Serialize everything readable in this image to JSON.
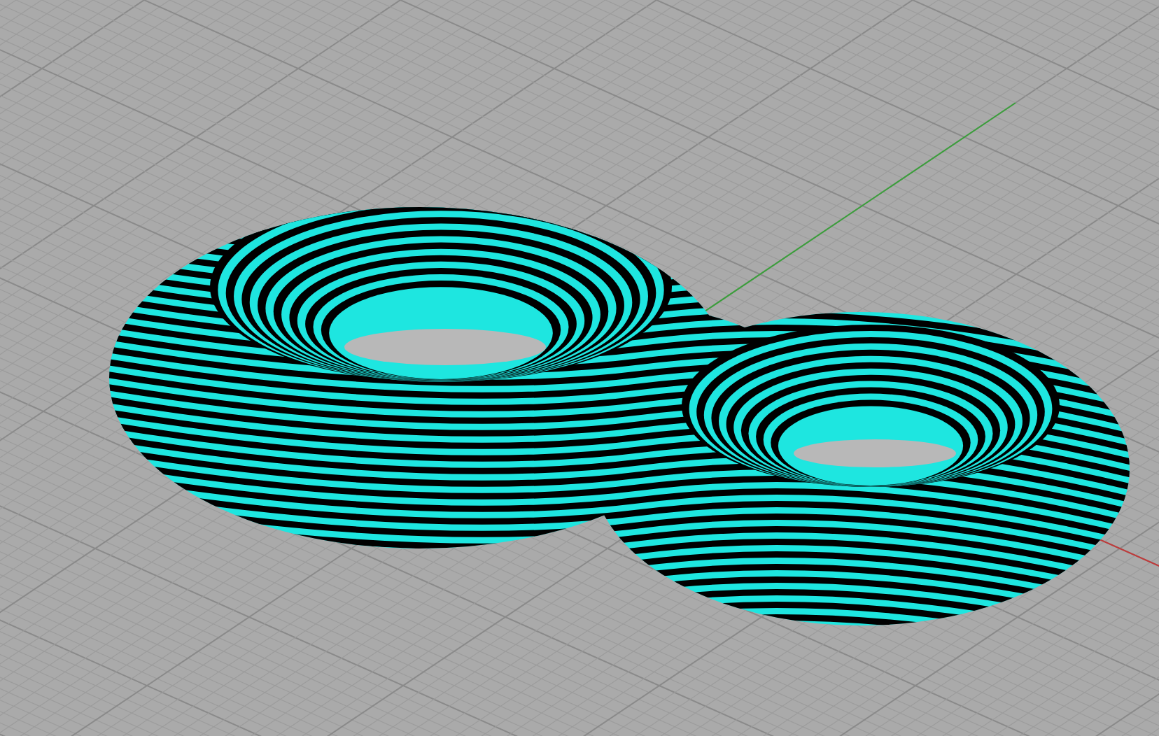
{
  "viewport": {
    "axes": [
      {
        "kind": "x",
        "color": "#c03a3a"
      },
      {
        "kind": "y",
        "color": "#3aa03a"
      }
    ]
  }
}
